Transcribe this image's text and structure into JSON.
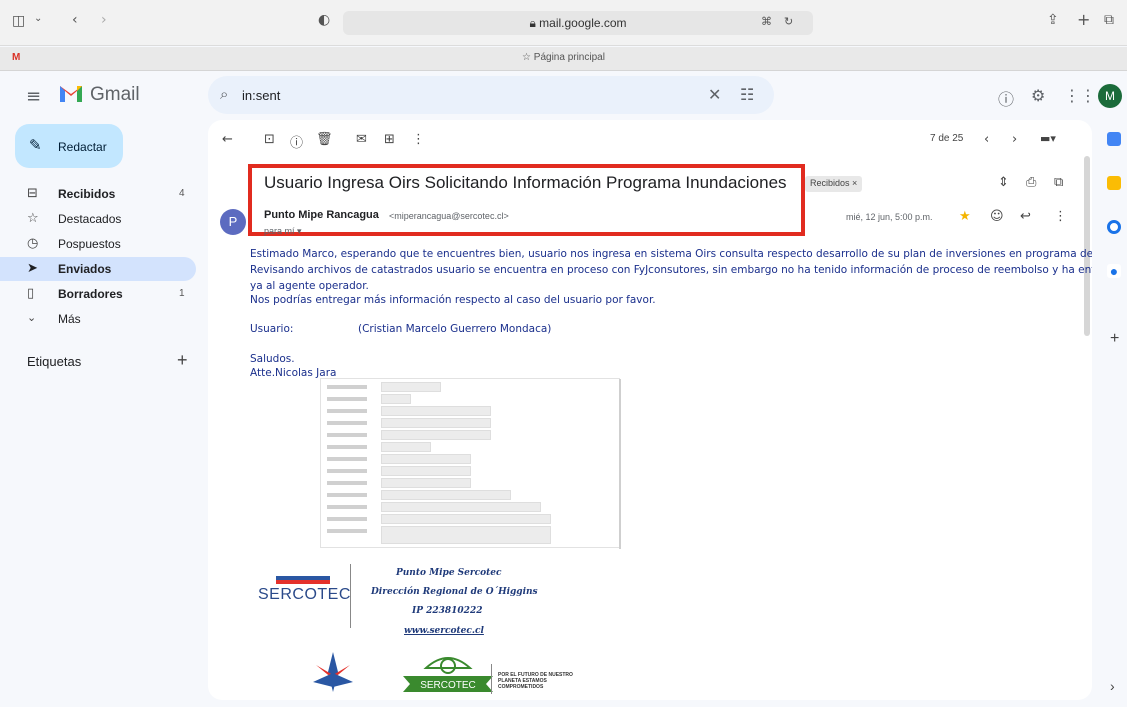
{
  "browser": {
    "url": "mail.google.com",
    "tab_title": "Página principal"
  },
  "gmail": {
    "app_name": "Gmail",
    "search_query": "in:sent",
    "account_initial": "M"
  },
  "nav": {
    "compose_label": "Redactar",
    "items": [
      {
        "label": "Recibidos",
        "count": "4",
        "icon": "inbox-icon",
        "bold": true
      },
      {
        "label": "Destacados",
        "count": "",
        "icon": "star-icon",
        "bold": false
      },
      {
        "label": "Pospuestos",
        "count": "",
        "icon": "clock-icon",
        "bold": false
      },
      {
        "label": "Enviados",
        "count": "",
        "icon": "send-icon",
        "bold": true,
        "active": true
      },
      {
        "label": "Borradores",
        "count": "1",
        "icon": "draft-icon",
        "bold": true
      },
      {
        "label": "Más",
        "count": "",
        "icon": "chevron-down-icon",
        "bold": false
      }
    ],
    "labels_title": "Etiquetas"
  },
  "message": {
    "pager": "7 de 25",
    "subject": "Usuario Ingresa Oirs Solicitando Información Programa Inundaciones",
    "label_chip": "Recibidos ×",
    "sender_initial": "P",
    "sender_name": "Punto Mipe Rancagua",
    "sender_email": "<miperancagua@sercotec.cl>",
    "to": "para mí ▾",
    "date": "mié, 12 jun, 5:00 p.m.",
    "body": {
      "line1": "Estimado Marco, esperando que te encuentres bien, usuario nos ingresa en sistema Oirs consulta respecto desarrollo de su plan de inversiones en programa de inundaciones.",
      "line2": "Revisando archivos de catastrados usuario se encuentra en proceso con FyJconsutores, sin embargo no ha tenido información de proceso de reembolso y  ha entregado facturas",
      "line3": "ya al agente operador.",
      "line4": "Nos podrías entregar más información respecto al caso del usuario por favor.",
      "user_label": "Usuario:",
      "user_value": "(Cristian Marcelo Guerrero Mondaca)",
      "greeting": "Saludos.",
      "signoff": "Atte.Nicolas Jara"
    },
    "signature": {
      "name": "Punto Mipe Sercotec",
      "region": "Dirección Regional de O´Higgins",
      "phone": "IP 223810222",
      "web": "www.sercotec.cl",
      "logo_text": "SERCOTEC",
      "tagline": "POR EL FUTURO DE NUESTRO PLANETA ESTAMOS COMPROMETIDOS"
    }
  }
}
